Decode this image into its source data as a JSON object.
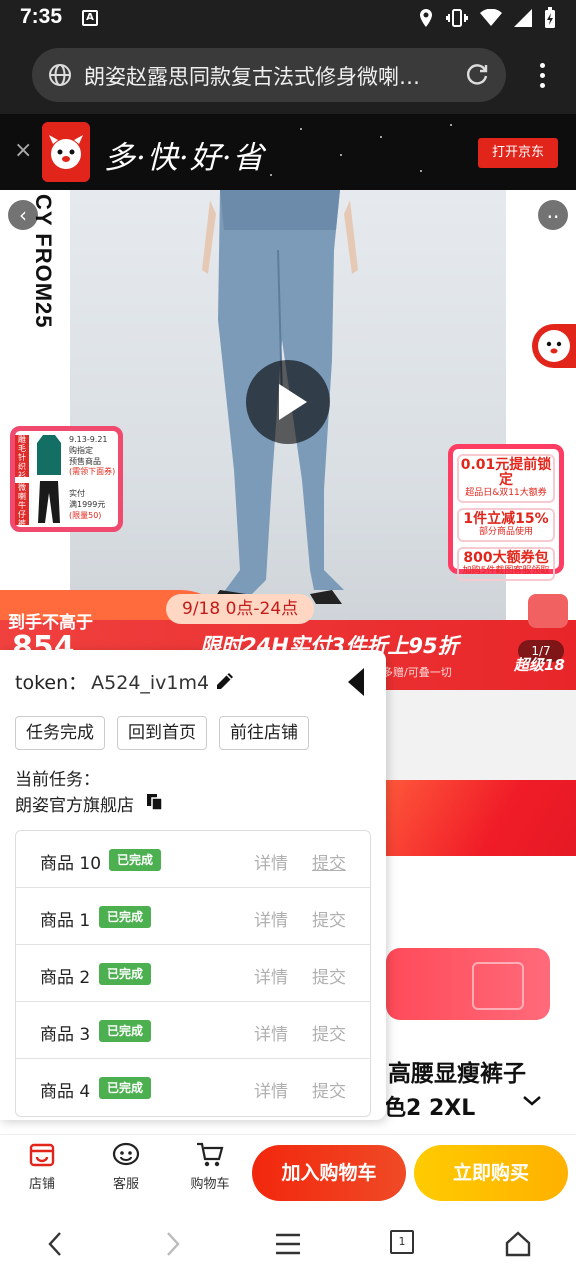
{
  "status_bar": {
    "time": "7:35",
    "notif_letter": "A"
  },
  "browser": {
    "url_title": "朗姿赵露思同款复古法式修身微喇…"
  },
  "jd_banner": {
    "slogan": "多·快·好·省",
    "open_button": "打开京东",
    "close": "×"
  },
  "product_image": {
    "brand_vertical": "CY FROM25",
    "left_promo": {
      "tag1": "雕毛针织衫",
      "tag2": "微喇牛仔裤",
      "line1": "9.13-9.21",
      "line2": "购指定",
      "line3": "预售商品",
      "line4": "(需领下面券)",
      "line5": "实付",
      "line6": "满1999元",
      "line7": "(限量50)"
    },
    "right_promo": {
      "r1a": "0.01元提前锁定",
      "r1b": "超品日&双11大额券",
      "r2a": "1件立减15%",
      "r2b": "部分商品使用",
      "r3a": "800大额券包",
      "r3b": "加购5件截图客服领取"
    },
    "sale": {
      "date": "9/18  0点-24点",
      "left_text": "到手不高于",
      "price": "854",
      "title": "限时24H实付3件折上95折",
      "sub": "多赠/可叠一切",
      "counter": "1/7",
      "level": "超级18"
    }
  },
  "token_panel": {
    "token_label": "token：",
    "token_value": "A524_iv1m4",
    "buttons": [
      "任务完成",
      "回到首页",
      "前往店铺"
    ],
    "current_task_label": "当前任务：",
    "current_task": "朗姿官方旗舰店",
    "tasks": [
      {
        "name": "商品 10",
        "status": "已完成",
        "detail": "详情",
        "submit": "提交"
      },
      {
        "name": "商品 1",
        "status": "已完成",
        "detail": "详情",
        "submit": "提交"
      },
      {
        "name": "商品 2",
        "status": "已完成",
        "detail": "详情",
        "submit": "提交"
      },
      {
        "name": "商品 3",
        "status": "已完成",
        "detail": "详情",
        "submit": "提交"
      },
      {
        "name": "商品 4",
        "status": "已完成",
        "detail": "详情",
        "submit": "提交"
      }
    ]
  },
  "product_title": {
    "line1": "高腰显瘦裤子",
    "line2": "色2 2XL"
  },
  "action_bar": {
    "store": "店铺",
    "service": "客服",
    "cart": "购物车",
    "add_to_cart": "加入购物车",
    "buy_now": "立即购买"
  },
  "nav_bar": {
    "tabs_count": "1"
  },
  "colors": {
    "jd_red": "#e1251b",
    "badge_green": "#4caf50",
    "buy_yellow": "#ffc000"
  }
}
